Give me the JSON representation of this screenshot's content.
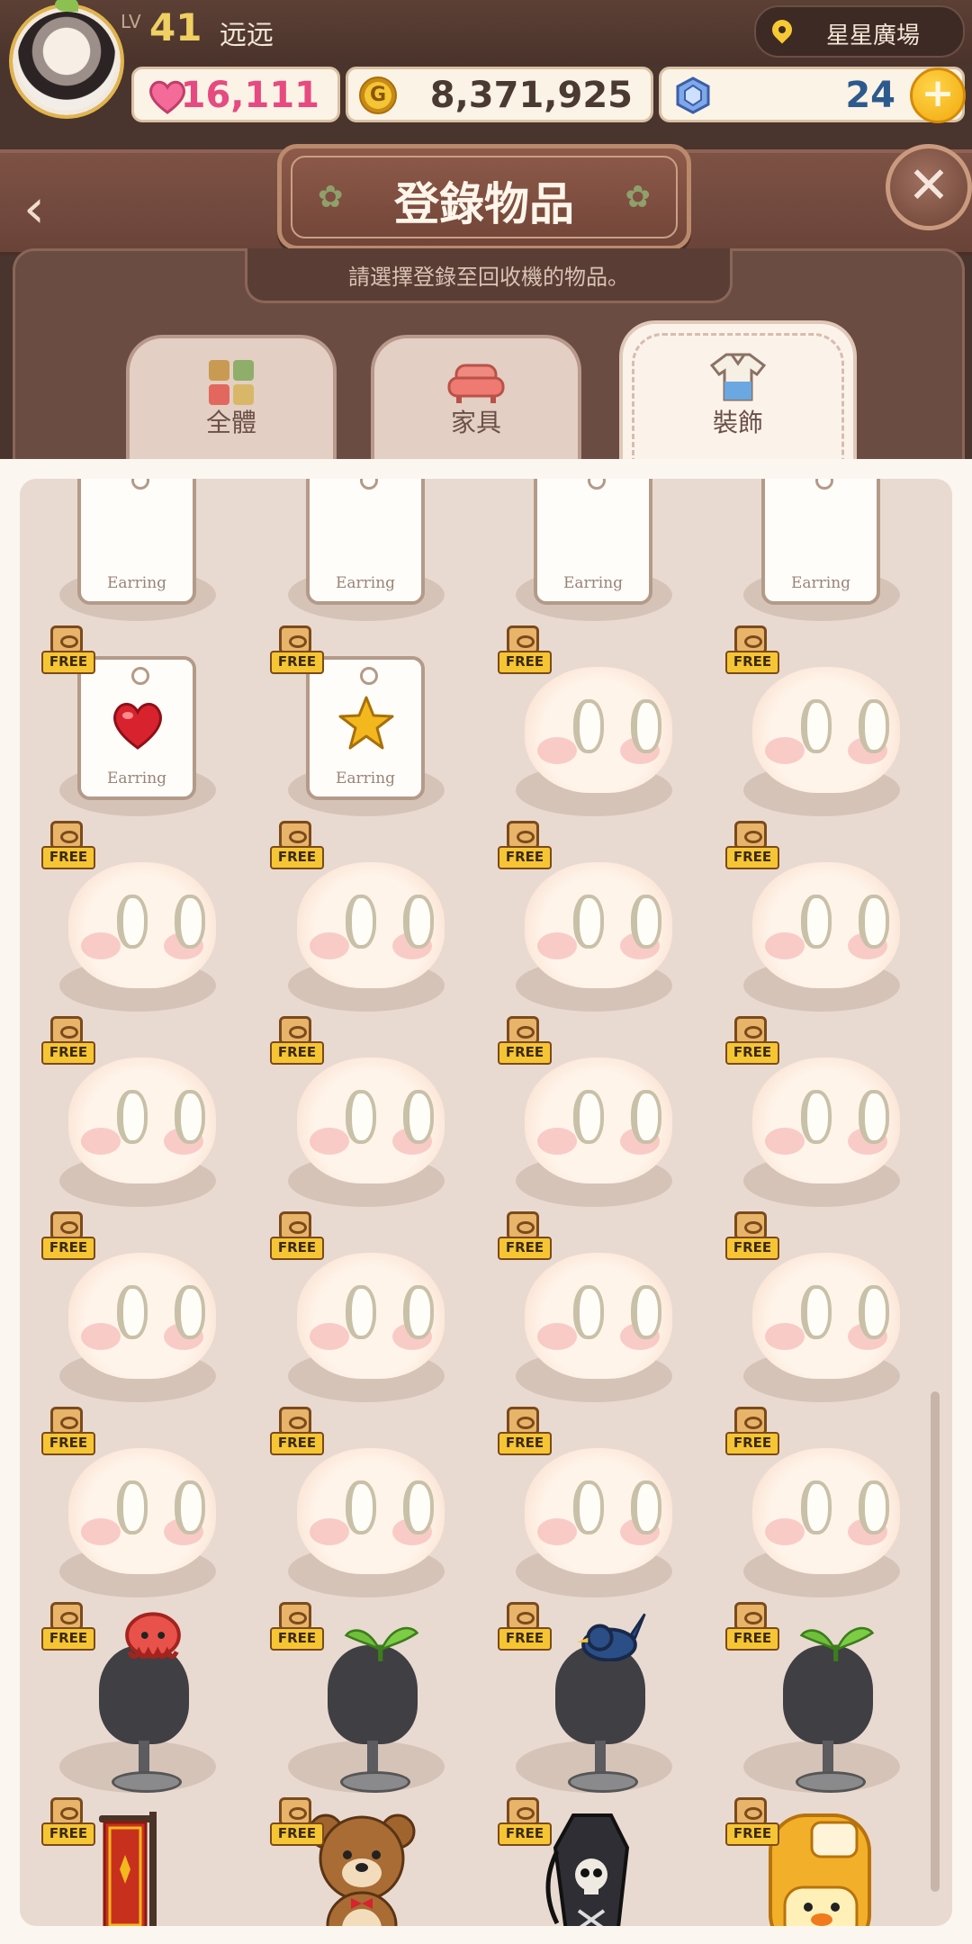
{
  "hud": {
    "level_prefix": "LV",
    "level": "41",
    "player_name": "远远",
    "location": "星星廣場",
    "hearts": "16,111",
    "gold": "8,371,925",
    "gems": "24",
    "plus": "+",
    "coin_letter": "G"
  },
  "header": {
    "title": "登錄物品",
    "subtitle": "請選擇登錄至回收機的物品。",
    "back": "‹",
    "close": "✕"
  },
  "tabs": [
    {
      "label": "全體",
      "icon": "grid-icon",
      "selected": false
    },
    {
      "label": "家具",
      "icon": "sofa-icon",
      "selected": false
    },
    {
      "label": "裝飾",
      "icon": "shirt-icon",
      "selected": true
    }
  ],
  "free_label": "FREE",
  "earring_label": "Earring",
  "items": [
    {
      "type": "earring",
      "art": "partial",
      "free": false
    },
    {
      "type": "earring",
      "art": "partial",
      "free": false
    },
    {
      "type": "earring",
      "art": "partial",
      "free": false
    },
    {
      "type": "earring",
      "art": "partial",
      "free": false
    },
    {
      "type": "earring",
      "art": "red-heart",
      "free": true
    },
    {
      "type": "earring",
      "art": "gold-star",
      "free": true
    },
    {
      "type": "face",
      "free": true
    },
    {
      "type": "face",
      "free": true
    },
    {
      "type": "face",
      "free": true
    },
    {
      "type": "face",
      "free": true
    },
    {
      "type": "face",
      "free": true
    },
    {
      "type": "face",
      "free": true
    },
    {
      "type": "face",
      "free": true
    },
    {
      "type": "face",
      "free": true
    },
    {
      "type": "face",
      "free": true
    },
    {
      "type": "face",
      "free": true
    },
    {
      "type": "face",
      "free": true
    },
    {
      "type": "face",
      "free": true
    },
    {
      "type": "face",
      "free": true
    },
    {
      "type": "face",
      "free": true
    },
    {
      "type": "face",
      "free": true
    },
    {
      "type": "face",
      "free": true
    },
    {
      "type": "face",
      "free": true
    },
    {
      "type": "face",
      "free": true
    },
    {
      "type": "mannequin",
      "art": "red-octopus-hat",
      "free": true
    },
    {
      "type": "mannequin",
      "art": "sprout-hat",
      "free": true
    },
    {
      "type": "mannequin",
      "art": "blue-bird-hat",
      "free": true
    },
    {
      "type": "mannequin",
      "art": "sprout-hat",
      "free": true
    },
    {
      "type": "banner",
      "art": "red-banner",
      "free": true
    },
    {
      "type": "bear",
      "art": "teddy-bear",
      "free": true
    },
    {
      "type": "coffin-bag",
      "art": "skull-coffin-backpack",
      "free": true
    },
    {
      "type": "backpack",
      "art": "yellow-duck-backpack",
      "free": true
    }
  ],
  "colors": {
    "accent": "#f6c534",
    "heart": "#e64a80",
    "panel": "#e9dad1",
    "header": "#6a4338"
  }
}
